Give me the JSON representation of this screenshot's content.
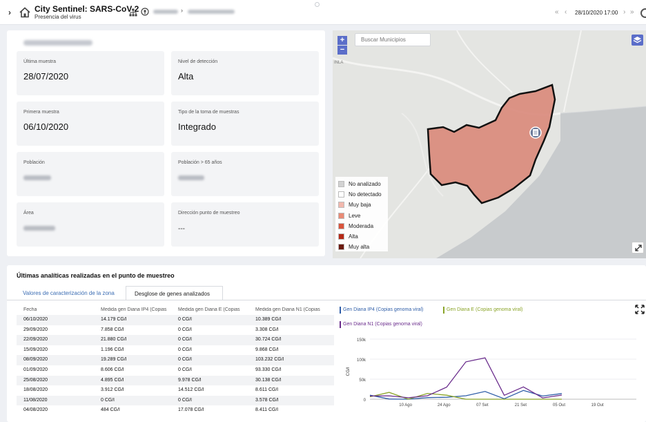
{
  "topbar": {
    "title": "City Sentinel: SARS-CoV-2",
    "subtitle": "Presencia del virus",
    "datetime": "28/10/2020 17:00"
  },
  "info": {
    "cards": [
      {
        "label": "Última muestra",
        "value": "28/07/2020"
      },
      {
        "label": "Nivel de detección",
        "value": "Alta"
      },
      {
        "label": "Primera muestra",
        "value": "06/10/2020"
      },
      {
        "label": "Tipo de la toma de muestras",
        "value": "Integrado"
      },
      {
        "label": "Población",
        "value": ""
      },
      {
        "label": "Población > 65 años",
        "value": ""
      },
      {
        "label": "Área",
        "value": ""
      },
      {
        "label": "Dirección punto de muestreo",
        "value": "---"
      }
    ]
  },
  "map": {
    "search_placeholder": "Buscar Municipios",
    "zoom_in": "+",
    "zoom_out": "−",
    "place_label": "INLA",
    "legend": [
      {
        "label": "No analizado",
        "color": "#d2d2d2"
      },
      {
        "label": "No detectado",
        "color": "#ffffff"
      },
      {
        "label": "Muy baja",
        "color": "#f2b8ad"
      },
      {
        "label": "Leve",
        "color": "#e98a75"
      },
      {
        "label": "Moderada",
        "color": "#d9543c"
      },
      {
        "label": "Alta",
        "color": "#b52a17"
      },
      {
        "label": "Muy alta",
        "color": "#6b1a0e"
      }
    ],
    "region_color": "#d9887a"
  },
  "analytics": {
    "title": "Últimas analíticas realizadas en el punto de muestreo",
    "tabs": [
      "Valores de caracterización de la zona",
      "Desglose de genes analizados"
    ],
    "columns": [
      "Fecha",
      "Medida gen Diana IP4 (Copias",
      "Medida gen Diana E (Copias",
      "Medida gen Diana N1 (Copias"
    ],
    "rows": [
      [
        "06/10/2020",
        "14.179 CG/l",
        "0 CG/l",
        "10.389 CG/l"
      ],
      [
        "29/09/2020",
        "7.858 CG/l",
        "0 CG/l",
        "3.308 CG/l"
      ],
      [
        "22/09/2020",
        "21.880 CG/l",
        "0 CG/l",
        "30.724 CG/l"
      ],
      [
        "15/09/2020",
        "1.196 CG/l",
        "0 CG/l",
        "9.868 CG/l"
      ],
      [
        "08/09/2020",
        "19.289 CG/l",
        "0 CG/l",
        "103.232 CG/l"
      ],
      [
        "01/09/2020",
        "8.606 CG/l",
        "0 CG/l",
        "93.330 CG/l"
      ],
      [
        "25/08/2020",
        "4.895 CG/l",
        "9.978 CG/l",
        "30.138 CG/l"
      ],
      [
        "18/08/2020",
        "3.912 CG/l",
        "14.512 CG/l",
        "8.611 CG/l"
      ],
      [
        "11/08/2020",
        "0 CG/l",
        "0 CG/l",
        "3.578 CG/l"
      ],
      [
        "04/08/2020",
        "484 CG/l",
        "17.078 CG/l",
        "8.411 CG/l"
      ]
    ]
  },
  "chart_data": {
    "type": "line",
    "ylabel": "CG/l",
    "ylim": [
      0,
      150000
    ],
    "yticks": [
      "0",
      "50k",
      "100k",
      "150k"
    ],
    "xticks": [
      "10 Ago",
      "24 Ago",
      "07 Set",
      "21 Set",
      "05 Out",
      "19 Out"
    ],
    "x": [
      "28/07",
      "04/08",
      "11/08",
      "18/08",
      "25/08",
      "01/09",
      "08/09",
      "15/09",
      "22/09",
      "29/09",
      "06/10"
    ],
    "series": [
      {
        "name": "Gen Diana IP4 (Copias genoma viral)",
        "color": "#2f5ea8",
        "values": [
          10000,
          484,
          0,
          3912,
          4895,
          8606,
          19289,
          1196,
          21880,
          7858,
          14179
        ]
      },
      {
        "name": "Gen Diana E (Copias genoma viral)",
        "color": "#8aa428",
        "values": [
          6000,
          17078,
          0,
          14512,
          9978,
          0,
          0,
          0,
          0,
          0,
          0
        ]
      },
      {
        "name": "Gen Diana N1 (Copias genoma viral)",
        "color": "#6a2c8c",
        "values": [
          8000,
          8411,
          3578,
          8611,
          30138,
          93330,
          103232,
          9868,
          30724,
          3308,
          10389
        ]
      }
    ]
  }
}
